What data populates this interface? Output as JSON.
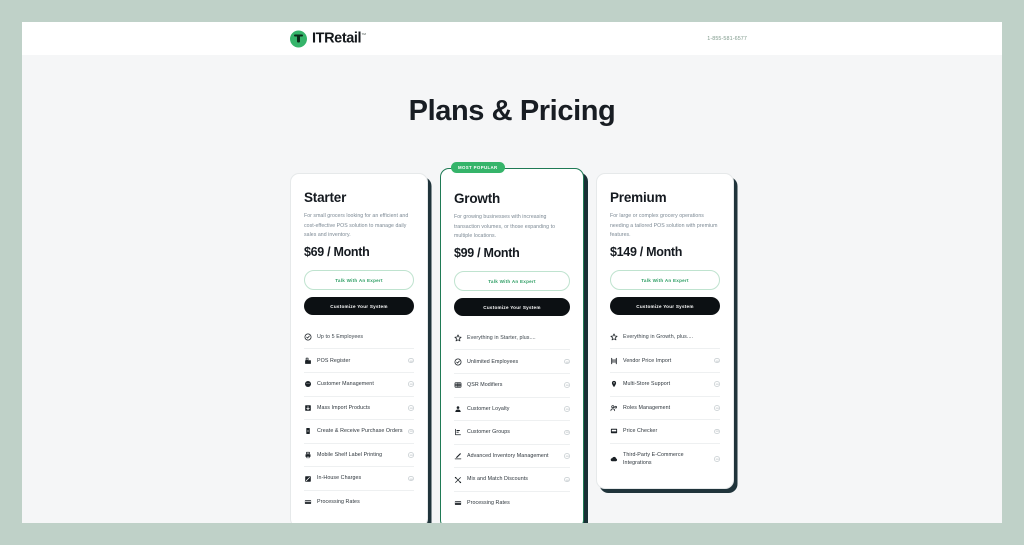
{
  "header": {
    "brand_it": "IT",
    "brand_retail": "Retail",
    "brand_tm": "™",
    "phone": "1-855-581-6577",
    "logo_icon": "itretail-circle-logo"
  },
  "main": {
    "title": "Plans & Pricing"
  },
  "colors": {
    "brand_green": "#35b46a",
    "featured_border": "#1f7a55",
    "dark_button": "#0c1013",
    "page_bg": "#f5f6f7",
    "outer_bg": "#bfd1c8"
  },
  "plans": [
    {
      "name": "Starter",
      "description": "For small grocers looking for an efficient and cost-effective POS solution to manage daily sales and inventory.",
      "price": "$69 / Month",
      "badge": "",
      "featured": false,
      "expert_button": "Talk With An Expert",
      "customize_button": "Customize Your System",
      "features": [
        {
          "label": "Up to 5 Employees",
          "icon": "check-circle-icon",
          "info": false
        },
        {
          "label": "POS Register",
          "icon": "register-icon",
          "info": true
        },
        {
          "label": "Customer Management",
          "icon": "customer-icon",
          "info": true
        },
        {
          "label": "Mass Import Products",
          "icon": "import-icon",
          "info": true
        },
        {
          "label": "Create & Receive Purchase Orders",
          "icon": "purchase-order-icon",
          "info": true
        },
        {
          "label": "Mobile Shelf Label Printing",
          "icon": "printer-icon",
          "info": true
        },
        {
          "label": "In-House Charges",
          "icon": "charges-icon",
          "info": true
        },
        {
          "label": "Processing Rates",
          "icon": "card-icon",
          "info": false
        }
      ]
    },
    {
      "name": "Growth",
      "description": "For growing businesses with increasing transaction volumes, or those expanding to multiple locations.",
      "price": "$99 / Month",
      "badge": "MOST POPULAR",
      "featured": true,
      "expert_button": "Talk With An Expert",
      "customize_button": "Customize Your System",
      "features": [
        {
          "label": "Everything in Starter, plus....",
          "icon": "star-icon",
          "info": false
        },
        {
          "label": "Unlimited Employees",
          "icon": "check-circle-icon",
          "info": true
        },
        {
          "label": "QSR Modifiers",
          "icon": "grid-icon",
          "info": true
        },
        {
          "label": "Customer Loyalty",
          "icon": "loyalty-icon",
          "info": true
        },
        {
          "label": "Customer Groups",
          "icon": "groups-icon",
          "info": true
        },
        {
          "label": "Advanced Inventory Management",
          "icon": "inventory-icon",
          "info": true
        },
        {
          "label": "Mix and Match Discounts",
          "icon": "scissors-icon",
          "info": true
        },
        {
          "label": "Processing Rates",
          "icon": "card-icon",
          "info": false
        }
      ]
    },
    {
      "name": "Premium",
      "description": "For large or complex grocery operations needing a tailored POS solution with premium features.",
      "price": "$149 / Month",
      "badge": "",
      "featured": false,
      "expert_button": "Talk With An Expert",
      "customize_button": "Customize Your System",
      "features": [
        {
          "label": "Everything in Growth, plus....",
          "icon": "star-icon",
          "info": false
        },
        {
          "label": "Vendor Price Import",
          "icon": "vendor-icon",
          "info": true
        },
        {
          "label": "Multi-Store Support",
          "icon": "store-pin-icon",
          "info": true
        },
        {
          "label": "Roles Management",
          "icon": "roles-icon",
          "info": true
        },
        {
          "label": "Price Checker",
          "icon": "price-checker-icon",
          "info": true
        },
        {
          "label": "Third-Party E-Commerce Integrations",
          "icon": "cloud-icon",
          "info": true
        }
      ]
    }
  ]
}
